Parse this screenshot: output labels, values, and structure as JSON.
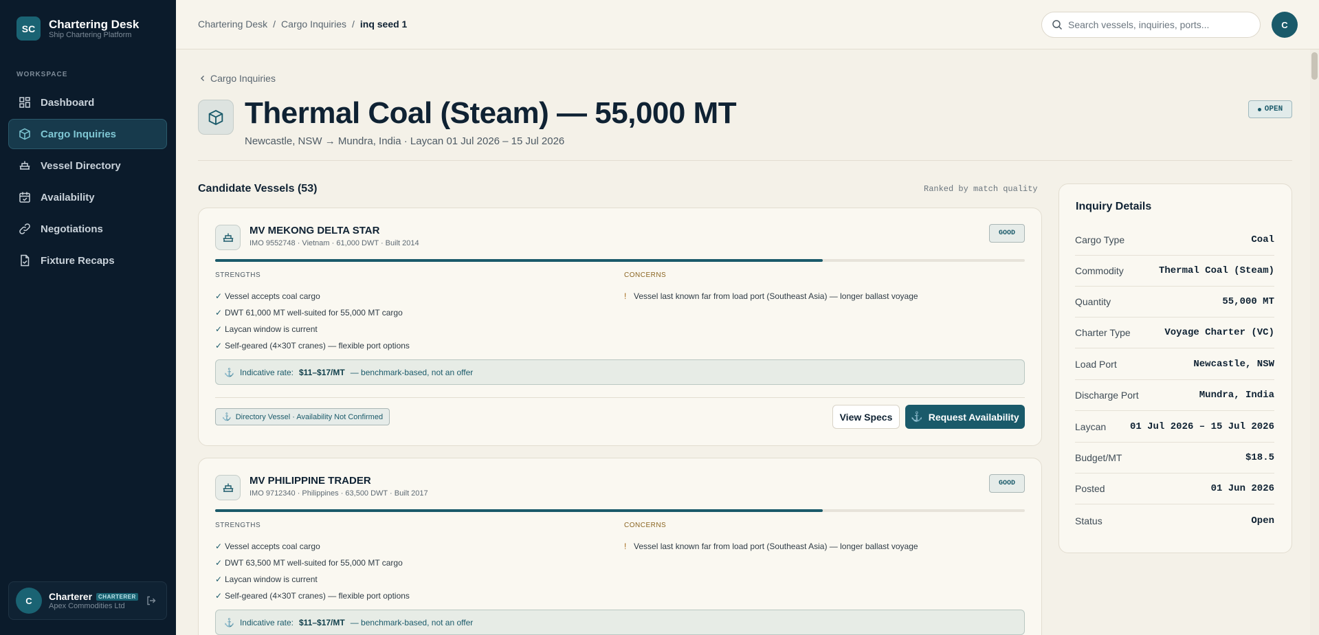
{
  "sidebar": {
    "logo": "SC",
    "brand_name": "Chartering Desk",
    "brand_sub": "Ship Chartering Platform",
    "section_label": "WORKSPACE",
    "items": [
      {
        "label": "Dashboard",
        "icon": "grid-icon"
      },
      {
        "label": "Cargo Inquiries",
        "icon": "box-icon"
      },
      {
        "label": "Vessel Directory",
        "icon": "ship-icon"
      },
      {
        "label": "Availability",
        "icon": "calendar-icon"
      },
      {
        "label": "Negotiations",
        "icon": "link-icon"
      },
      {
        "label": "Fixture Recaps",
        "icon": "document-icon"
      }
    ],
    "active_index": 1,
    "user": {
      "initial": "C",
      "name": "Charterer",
      "role": "CHARTERER",
      "org": "Apex Commodities Ltd"
    }
  },
  "topbar": {
    "breadcrumbs": [
      "Chartering Desk",
      "Cargo Inquiries",
      "inq seed 1"
    ],
    "separator": "/",
    "search_placeholder": "Search vessels, inquiries, ports...",
    "avatar_initial": "C"
  },
  "inquiry": {
    "back_label": "Cargo Inquiries",
    "title": "Thermal Coal (Steam) — 55,000 MT",
    "subtitle": "Newcastle, NSW → Mundra, India · Laycan 01 Jul 2026 – 15 Jul 2026",
    "status_badge": "OPEN"
  },
  "candidates": {
    "heading": "Candidate Vessels (53)",
    "ranking_note": "Ranked by match quality",
    "strengths_label": "STRENGTHS",
    "concerns_label": "CONCERNS",
    "vessels": [
      {
        "name": "MV MEKONG DELTA STAR",
        "meta": "IMO 9552748 · Vietnam · 61,000 DWT · Built 2014",
        "match": "GOOD",
        "match_score": 0.75,
        "strengths": [
          "Vessel accepts coal cargo",
          "DWT 61,000 MT well-suited for 55,000 MT cargo",
          "Laycan window is current",
          "Self-geared (4×30T cranes) — flexible port options"
        ],
        "concerns": [
          "Vessel last known far from load port (Southeast Asia) — longer ballast voyage"
        ],
        "rate_prefix": "Indicative rate:",
        "rate_value": "$11–$17/MT",
        "rate_suffix": "— benchmark-based, not an offer",
        "directory_badge": "Directory Vessel · Availability Not Confirmed",
        "view_specs": "View Specs",
        "request": "Request Availability"
      },
      {
        "name": "MV PHILIPPINE TRADER",
        "meta": "IMO 9712340 · Philippines · 63,500 DWT · Built 2017",
        "match": "GOOD",
        "match_score": 0.75,
        "strengths": [
          "Vessel accepts coal cargo",
          "DWT 63,500 MT well-suited for 55,000 MT cargo",
          "Laycan window is current",
          "Self-geared (4×30T cranes) — flexible port options"
        ],
        "concerns": [
          "Vessel last known far from load port (Southeast Asia) — longer ballast voyage"
        ],
        "rate_prefix": "Indicative rate:",
        "rate_value": "$11–$17/MT",
        "rate_suffix": "— benchmark-based, not an offer"
      }
    ]
  },
  "details": {
    "heading": "Inquiry Details",
    "rows": [
      {
        "label": "Cargo Type",
        "value": "Coal"
      },
      {
        "label": "Commodity",
        "value": "Thermal Coal (Steam)"
      },
      {
        "label": "Quantity",
        "value": "55,000 MT"
      },
      {
        "label": "Charter Type",
        "value": "Voyage Charter (VC)"
      },
      {
        "label": "Load Port",
        "value": "Newcastle, NSW"
      },
      {
        "label": "Discharge Port",
        "value": "Mundra, India"
      },
      {
        "label": "Laycan",
        "value": "01 Jul 2026 – 15 Jul 2026"
      },
      {
        "label": "Budget/MT",
        "value": "$18.5"
      },
      {
        "label": "Posted",
        "value": "01 Jun 2026"
      },
      {
        "label": "Status",
        "value": "Open"
      }
    ]
  },
  "colors": {
    "sidebar_bg": "#0b1b2b",
    "accent": "#1a5a6a",
    "page_bg": "#f4f1e8",
    "concern": "#8a6420"
  }
}
